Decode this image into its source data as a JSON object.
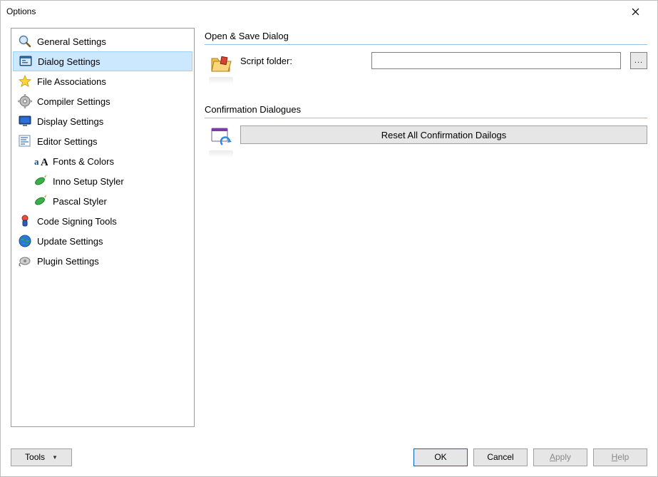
{
  "window": {
    "title": "Options"
  },
  "nav": {
    "items": [
      {
        "label": "General Settings",
        "icon": "magnifier"
      },
      {
        "label": "Dialog Settings",
        "icon": "dialog",
        "selected": true
      },
      {
        "label": "File Associations",
        "icon": "star"
      },
      {
        "label": "Compiler Settings",
        "icon": "gear"
      },
      {
        "label": "Display Settings",
        "icon": "monitor"
      },
      {
        "label": "Editor Settings",
        "icon": "editor"
      },
      {
        "label": "Fonts & Colors",
        "icon": "fonts",
        "indent": 1
      },
      {
        "label": "Inno Setup Styler",
        "icon": "pen",
        "indent": 1
      },
      {
        "label": "Pascal Styler",
        "icon": "pen",
        "indent": 1
      },
      {
        "label": "Code Signing Tools",
        "icon": "signer"
      },
      {
        "label": "Update Settings",
        "icon": "globe"
      },
      {
        "label": "Plugin Settings",
        "icon": "plugin"
      }
    ]
  },
  "group1": {
    "title": "Open & Save Dialog",
    "script_label": "Script folder:",
    "script_value": "",
    "browse_label": "..."
  },
  "group2": {
    "title": "Confirmation Dialogues",
    "reset_label": "Reset All Confirmation Dailogs"
  },
  "buttons": {
    "tools": "Tools",
    "ok": "OK",
    "cancel": "Cancel",
    "apply": "Apply",
    "help": "Help"
  }
}
